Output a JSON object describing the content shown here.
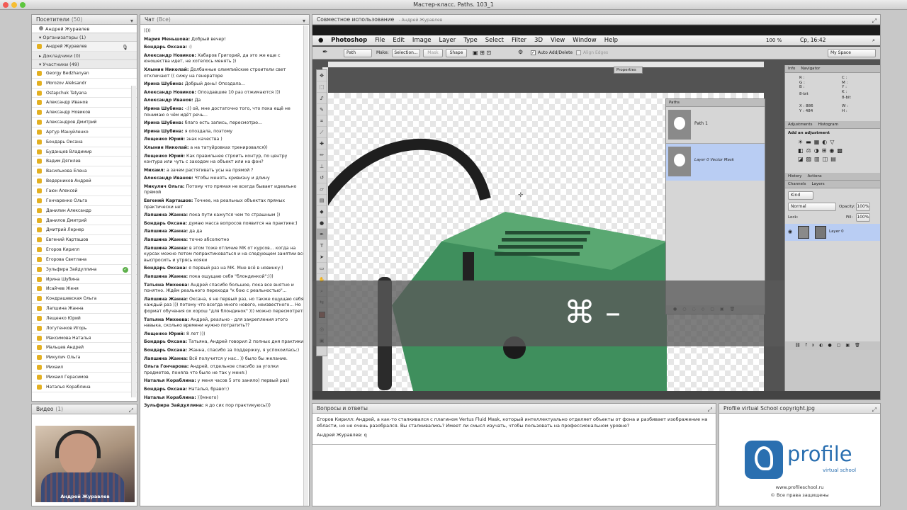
{
  "window_title": "Мастер-класс. Paths. 103_1",
  "attendees": {
    "title": "Посетители",
    "count": "(50)",
    "host": "Андрей Журавлев",
    "groups": [
      {
        "label": "Организаторы (1)"
      },
      {
        "label": "Докладчики (0)"
      },
      {
        "label": "Участники (49)"
      }
    ],
    "organizer": "Андрей Журавлев",
    "participants": [
      "Georgy Bedzhanyan",
      "Morozov Aleksandr",
      "Ostapchuk Tatyana",
      "Александр Иванов",
      "Александр Новиков",
      "Александров Дмитрий",
      "Артур Мануйленко",
      "Бондарь Оксана",
      "Буданцев Владимир",
      "Вадим Дягилев",
      "Васильхова Елена",
      "Ведерников Андрей",
      "Гаюн Алексей",
      "Гончаренко Ольга",
      "Данилин Александр",
      "Данилов Дмитрий",
      "Дмитрий Лернер",
      "Евгений Карташов",
      "Егоров Кирилл",
      "Егорова Светлана",
      "Зульфира Зайдуллина",
      "Ирина Шубина",
      "Исайчев Женя",
      "Кондрашевская Ольга",
      "Лапшина Жанна",
      "Лещенко Юрий",
      "Логутенков Игорь",
      "Максимова Наталья",
      "Мальцев Андрей",
      "Микулич Ольга",
      "Михаил",
      "Михаил Герасимов",
      "Наталья Кораблина"
    ]
  },
  "video": {
    "title": "Видео",
    "count": "(1)",
    "caption": "Андрей Журавлев"
  },
  "chat": {
    "title": "Чат",
    "count": "(Все)",
    "messages": [
      {
        "name": "",
        "text": "))))"
      },
      {
        "name": "Мария Меньшова:",
        "text": " Добрый вечер!"
      },
      {
        "name": "Бондарь Оксана:",
        "text": " :)"
      },
      {
        "name": "Александр Новиков:",
        "text": " Хабаров Григорий, да это же еще с юношества идет, не хотелось менять ))"
      },
      {
        "name": "Хлынин Николай:",
        "text": " Долбанные олимпийские строители свет отключают ((           сижу на генераторе"
      },
      {
        "name": "Ирина Шубина:",
        "text": " Добрый день! Опоздала..."
      },
      {
        "name": "Александр Новиков:",
        "text": " Опоздавшие 10 раз отжимаются )))"
      },
      {
        "name": "Александр Иванов:",
        "text": " Да"
      },
      {
        "name": "Ирина Шубина:",
        "text": " -:)) ой, мне достаточно того, что пока ещё не понимаю о чём идёт речь..."
      },
      {
        "name": "Ирина Шубина:",
        "text": " благо есть запись, пересмотрю..."
      },
      {
        "name": "Ирина Шубина:",
        "text": " я опоздала, поэтому"
      },
      {
        "name": "Лещенко Юрий:",
        "text": " знак качества )"
      },
      {
        "name": "Хлынин Николай:",
        "text": " а на татуйровках тренировался))"
      },
      {
        "name": "Лещенко Юрий:",
        "text": " Как правильнее строить контур, по центру контура или чуть с заходом на объект или на фон?"
      },
      {
        "name": "Михаил:",
        "text": " а зачем растягивать усы на прямой ?"
      },
      {
        "name": "Александр Иванов:",
        "text": " Чтобы менять кривизну и длину"
      },
      {
        "name": "Микулич Ольга:",
        "text": " Потому что прямая не всегда бывает идеально прямой"
      },
      {
        "name": "Евгений Карташов:",
        "text": " Точнее, на реальных объектах прямых практически нет"
      },
      {
        "name": "Лапшина Жанна:",
        "text": " пока пути кажутся чем то страшным ))"
      },
      {
        "name": "Бондарь Оксана:",
        "text": " думаю масса вопросов появится на практике:)"
      },
      {
        "name": "Лапшина Жанна:",
        "text": " да да"
      },
      {
        "name": "Лапшина Жанна:",
        "text": " точно абсолютно"
      },
      {
        "name": "Лапшина Жанна:",
        "text": " в этом тоже отличие МК от курсов... когда на курсах можно потом попрактиковаться и на следующем занятии всё выспросить и утрясь кояки"
      },
      {
        "name": "Бондарь Оксана:",
        "text": " я первый раз на МК. Мне всё в новинку:)"
      },
      {
        "name": "Лапшина Жанна:",
        "text": " пока ощущаю себя \"блондинкой\":)))"
      },
      {
        "name": "Татьяна Михеева:",
        "text": " Андрей спасибо большое, пока все внятно и понятно. Ждём реального перехода \"к бою с реальностью\"..."
      },
      {
        "name": "Лапшина Жанна:",
        "text": " Оксана, я не первый раз, но также ощущаю себя каждый раз ))) потому что  всегда много нового, неизвестного... Но формат обучения ох хорош \"для блондинок\" ))) можно пересмотреть"
      },
      {
        "name": "Татьяна Михеева:",
        "text": " Андрей, реально - для закрепления этого навыка, сколько времени нужно потратить??"
      },
      {
        "name": "Лещенко Юрий:",
        "text": " 8 лет )))"
      },
      {
        "name": "Бондарь Оксана:",
        "text": " Татьяна, Андрей говорил 2 полных дня практики"
      },
      {
        "name": "Бондарь Оксана:",
        "text": " Жанна, спасибо за поддержку, я успокоилась:)"
      },
      {
        "name": "Лапшина Жанна:",
        "text": " Всё получится у нас.. )) было бы желание."
      },
      {
        "name": "Ольга Гончарова:",
        "text": " Андрей, отдельное спасибо за уголки предметов, поняла что было не так у меня:)"
      },
      {
        "name": "Наталья Кораблина:",
        "text": " у меня часов 5 это заняло) первый раз)"
      },
      {
        "name": "Бондарь Оксана:",
        "text": " Наталья, браво!:)"
      },
      {
        "name": "Наталья Кораблина:",
        "text": " )))много)"
      },
      {
        "name": "Зульфира Зайдуллина:",
        "text": " я до сих пор практикуюсь)))"
      }
    ]
  },
  "share": {
    "title": "Совместное использование",
    "presenter": "- Андрей Журавлев"
  },
  "photoshop": {
    "menu": [
      "Photoshop",
      "File",
      "Edit",
      "Image",
      "Layer",
      "Type",
      "Select",
      "Filter",
      "3D",
      "View",
      "Window",
      "Help"
    ],
    "status_right": "100 %",
    "clock": "Ср, 16:42",
    "options": {
      "path": "Path",
      "make": "Make:",
      "selection": "Selection...",
      "mask": "Mask",
      "shape": "Shape",
      "auto": "Auto Add/Delete",
      "align": "Align Edges",
      "workspace": "My Space"
    },
    "properties_tab": "Properties",
    "paths_tab": "Paths",
    "path_items": [
      "Path 1",
      "Layer 0 Vector Mask"
    ],
    "info_tabs": [
      "Info",
      "Navigator"
    ],
    "info_values": {
      "r": "R :",
      "g": "G :",
      "b": "B :",
      "c": "C :",
      "m": "M :",
      "y": "Y :",
      "k": "K :",
      "bit1": "8-bit",
      "bit2": "8-bit",
      "x_label": "X :",
      "x_val": "886",
      "y_label": "Y :",
      "y_val": "484",
      "w": "W :",
      "h": "H :"
    },
    "adjust_tabs": [
      "Adjustments",
      "Histogram"
    ],
    "adjust_title": "Add an adjustment",
    "layer_tabs": [
      "History",
      "Actions"
    ],
    "layer_tabs2": [
      "Channels",
      "Layers"
    ],
    "layers": {
      "kind": "Kind",
      "blend": "Normal",
      "opacity_label": "Opacity:",
      "opacity": "100%",
      "lock": "Lock:",
      "fill_label": "Fill:",
      "fill": "100%",
      "layer_name": "Layer 0"
    },
    "overlay_key": "⌘ –"
  },
  "qa": {
    "title": "Вопросы и ответы",
    "question": "Егоров Кирилл: Андрей, а как-то сталкивался с плагином Vertus Fluid Mask, который интеллектуально отделяет объекты от фона и разбивает изображение на области, но не очень разобрался. Вы сталкивались? Имеет ли смысл изучать, чтобы пользовать на профессиональном уровне?",
    "answer": "Андрей Журавлев: q"
  },
  "copyright": {
    "title": "Profile virtual School copyright.jpg",
    "brand": "profile",
    "sub": "virtual school",
    "url": "www.profileschool.ru",
    "rights": "© Все права защищены",
    "brand_color": "#2a6fb0"
  }
}
